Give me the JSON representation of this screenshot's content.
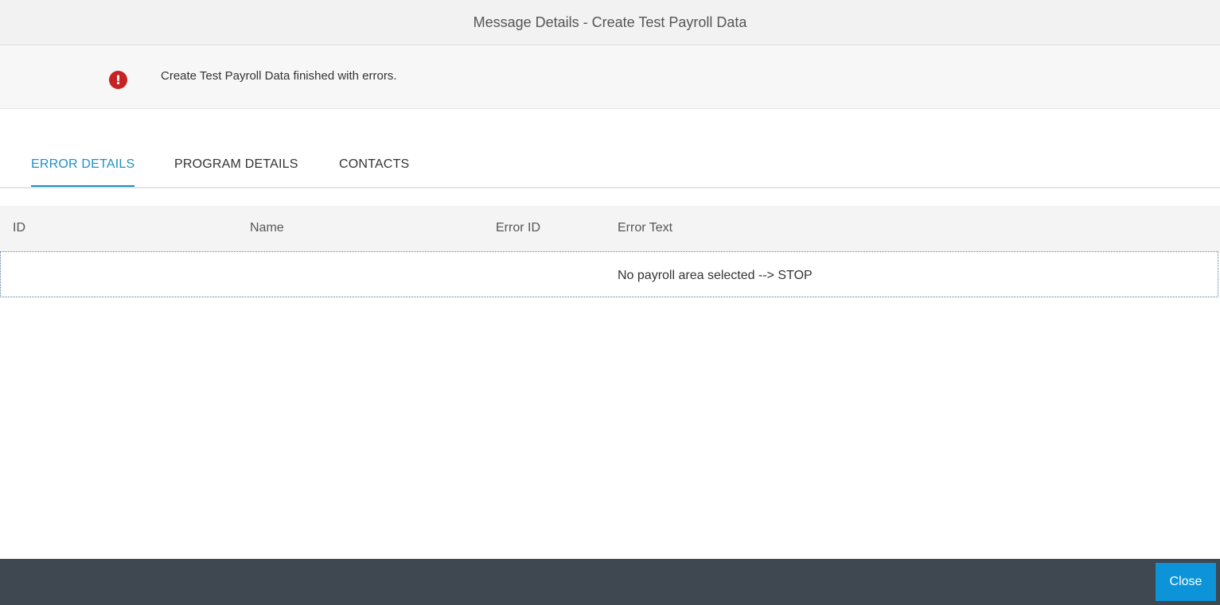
{
  "dialog": {
    "title": "Message Details - Create Test Payroll Data"
  },
  "message": {
    "icon": "error-icon",
    "icon_glyph": "!",
    "text": "Create Test Payroll Data finished with errors."
  },
  "tabs": [
    {
      "label": "ERROR DETAILS",
      "active": true
    },
    {
      "label": "PROGRAM DETAILS",
      "active": false
    },
    {
      "label": "CONTACTS",
      "active": false
    }
  ],
  "table": {
    "columns": [
      "ID",
      "Name",
      "Error ID",
      "Error Text"
    ],
    "rows": [
      {
        "id": "",
        "name": "",
        "error_id": "",
        "error_text": "No payroll area selected --> STOP"
      }
    ]
  },
  "footer": {
    "close_label": "Close"
  },
  "colors": {
    "accent": "#1e8fc9",
    "error": "#c62222",
    "footer_bg": "#3f4750",
    "button_bg": "#0d94d8"
  }
}
